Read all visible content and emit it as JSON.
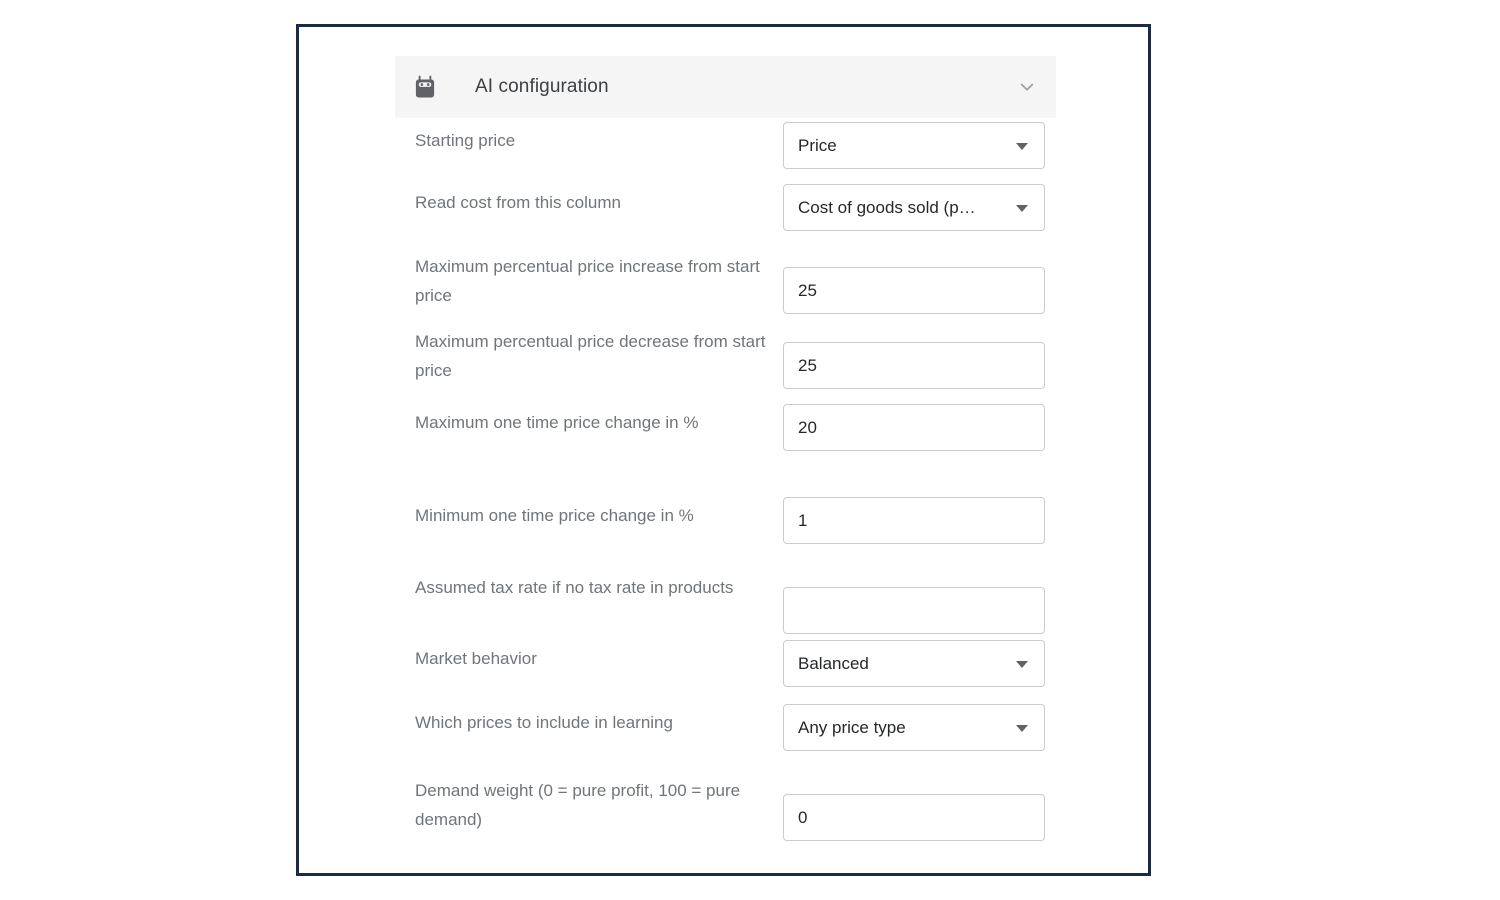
{
  "panel": {
    "icon": "robot-icon",
    "title": "AI configuration",
    "collapse_icon": "chevron-down-icon",
    "header_bg": "#f5f5f5"
  },
  "theme": {
    "frame_border": "#1b2a47",
    "label_color": "#70757a",
    "value_color": "#25282b",
    "control_border": "#c9cbcd"
  },
  "rows": [
    {
      "label": "Starting price",
      "type": "select",
      "value": "Price",
      "name": "starting-price"
    },
    {
      "label": "Read cost from this column",
      "type": "select",
      "value": "Cost of goods sold (p…",
      "name": "read-cost-from-this-column"
    },
    {
      "label": "Maximum percentual price increase from start price",
      "type": "text",
      "value": "25",
      "placeholder": "",
      "name": "maximum-percentual-price-increase"
    },
    {
      "label": "Maximum percentual price decrease from start price",
      "type": "text",
      "value": "25",
      "placeholder": "",
      "name": "maximum-percentual-price-decrease"
    },
    {
      "label": "Maximum one time price change in %",
      "type": "text",
      "value": "20",
      "placeholder": "",
      "name": "maximum-one-time-price-change"
    },
    {
      "label": "Minimum one time price change in %",
      "type": "text",
      "value": "1",
      "placeholder": "",
      "name": "minimum-one-time-price-change"
    },
    {
      "label": "Assumed tax rate if no tax rate in products",
      "type": "text",
      "value": "",
      "placeholder": "",
      "name": "assumed-tax-rate"
    },
    {
      "label": "Market behavior",
      "type": "select",
      "value": "Balanced",
      "name": "market-behavior"
    },
    {
      "label": "Which prices to include in learning",
      "type": "select",
      "value": "Any price type",
      "name": "which-prices-to-include-in-learning"
    },
    {
      "label": "Demand weight (0 = pure profit, 100 = pure demand)",
      "type": "text",
      "value": "0",
      "placeholder": "",
      "name": "demand-weight"
    }
  ]
}
